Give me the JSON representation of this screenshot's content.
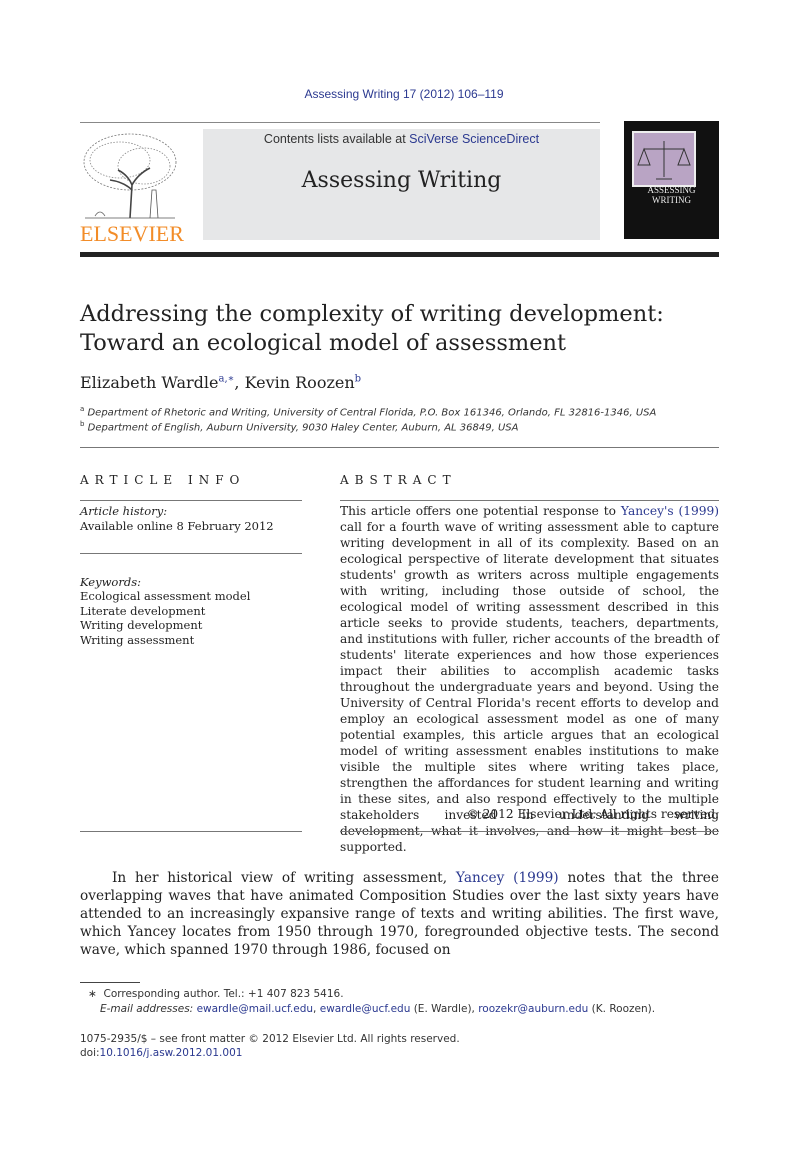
{
  "header": {
    "journal_citation": "Assessing Writing 17 (2012) 106–119",
    "contents_prefix": "Contents lists available at ",
    "contents_link": "SciVerse ScienceDirect",
    "journal_title": "Assessing Writing",
    "publisher_logo_text": "ELSEVIER",
    "cover_title_line1": "ASSESSING",
    "cover_title_line2": "WRITING"
  },
  "colors": {
    "link": "#2b3990",
    "publisher_orange": "#f28c28",
    "banner_gray": "#e6e7e8"
  },
  "article": {
    "title_line1": "Addressing the complexity of writing development:",
    "title_line2": "Toward an ecological model of assessment",
    "authors": [
      {
        "name": "Elizabeth Wardle",
        "sup": "a,∗"
      },
      {
        "name": "Kevin Roozen",
        "sup": "b"
      }
    ],
    "affiliations": [
      {
        "mark": "a",
        "text": "Department of Rhetoric and Writing, University of Central Florida, P.O. Box 161346, Orlando, FL 32816-1346, USA"
      },
      {
        "mark": "b",
        "text": "Department of English, Auburn University, 9030 Haley Center, Auburn, AL 36849, USA"
      }
    ]
  },
  "article_info": {
    "heading": "ARTICLE INFO",
    "history_label": "Article history:",
    "history_value": "Available online 8 February 2012",
    "keywords_label": "Keywords:",
    "keywords": [
      "Ecological assessment model",
      "Literate development",
      "Writing development",
      "Writing assessment"
    ]
  },
  "abstract": {
    "heading": "ABSTRACT",
    "text_before_link": "This article offers one potential response to ",
    "link": "Yancey's (1999)",
    "text_after_link": " call for a fourth wave of writing assessment able to capture writing development in all of its complexity. Based on an ecological perspective of literate development that situates students' growth as writers across multiple engagements with writing, including those outside of school, the ecological model of writing assessment described in this article seeks to provide students, teachers, departments, and institutions with fuller, richer accounts of the breadth of students' literate experiences and how those experiences impact their abilities to accomplish academic tasks throughout the undergraduate years and beyond. Using the University of Central Florida's recent efforts to develop and employ an ecological assessment model as one of many potential examples, this article argues that an ecological model of writing assessment enables institutions to make visible the multiple sites where writing takes place, strengthen the affordances for student learning and writing in these sites, and also respond effectively to the multiple stakeholders invested in understanding writing development, what it involves, and how it might best be supported.",
    "copyright": "© 2012 Elsevier Ltd. All rights reserved."
  },
  "body": {
    "p1_before_link": "In her historical view of writing assessment, ",
    "p1_link": "Yancey (1999)",
    "p1_after_link": " notes that the three overlapping waves that have animated Composition Studies over the last sixty years have attended to an increasingly expansive range of texts and writing abilities. The first wave, which Yancey locates from 1950 through 1970, foregrounded objective tests. The second wave, which spanned 1970 through 1986, focused on"
  },
  "footnotes": {
    "star": "∗",
    "corresponding": "Corresponding author. Tel.: +1 407 823 5416.",
    "email_label": "E-mail addresses:",
    "email1": "ewardle@mail.ucf.edu",
    "sep1": ", ",
    "email2": "ewardle@ucf.edu",
    "email2_owner": " (E. Wardle), ",
    "email3": "roozekr@auburn.edu",
    "email3_owner": " (K. Roozen)."
  },
  "front_matter": {
    "issn_line": "1075-2935/$ – see front matter © 2012 Elsevier Ltd. All rights reserved.",
    "doi_label": "doi:",
    "doi": "10.1016/j.asw.2012.01.001"
  }
}
